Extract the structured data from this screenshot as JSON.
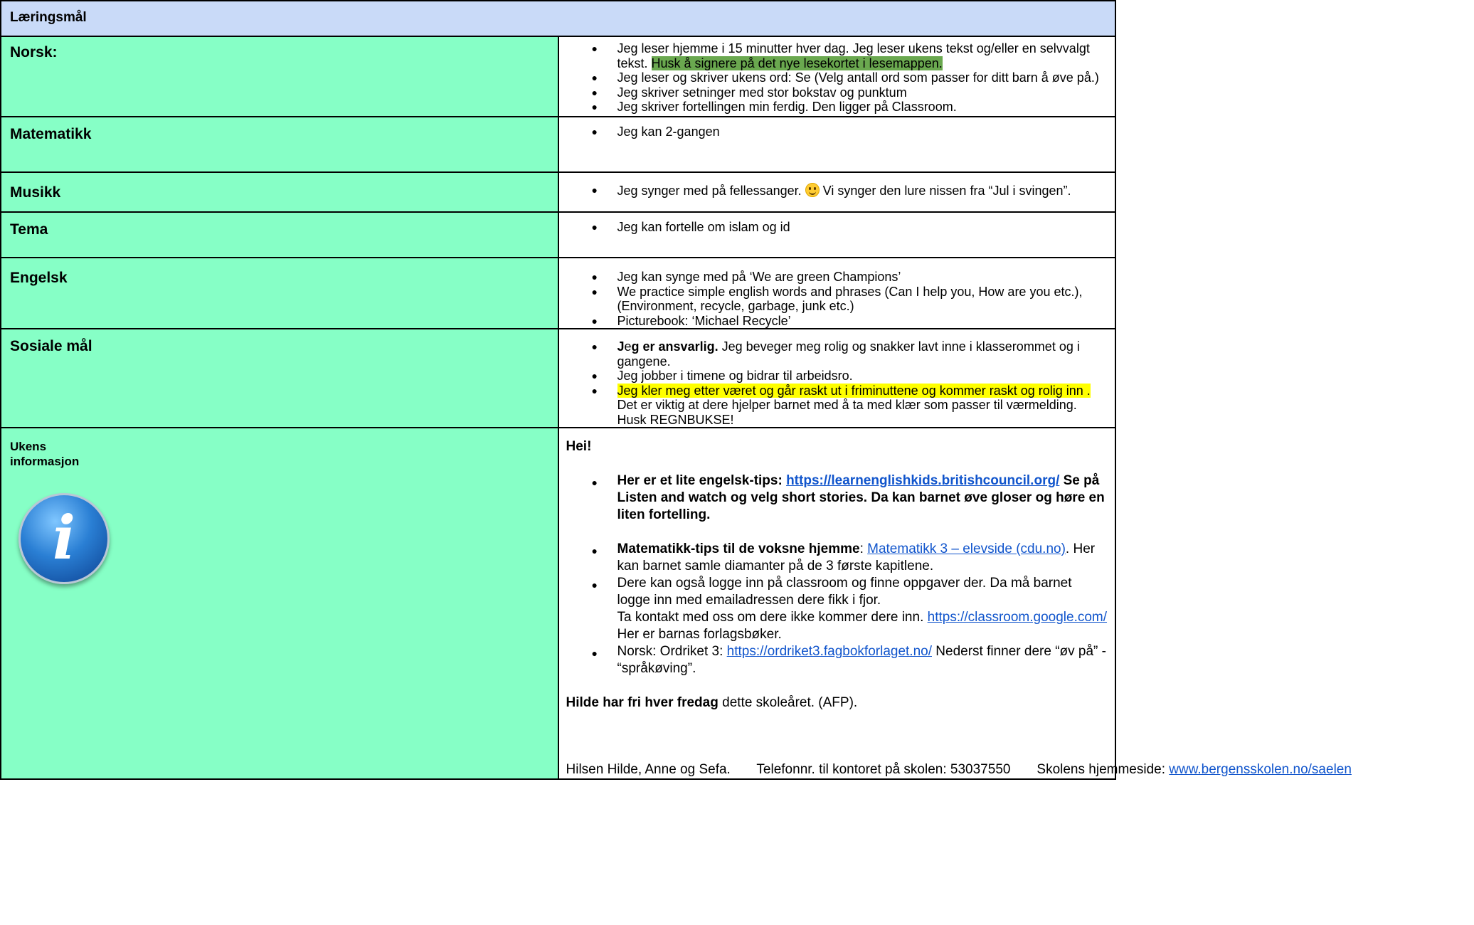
{
  "header": {
    "title": "Læringsmål"
  },
  "rows": {
    "norsk": {
      "label": "Norsk:",
      "b1": "Jeg leser hjemme i 15 minutter hver dag. Jeg leser ukens tekst og/eller en selvvalgt tekst. ",
      "b1_highlight": "Husk å signere på det nye lesekortet i lesemappen.",
      "b2": "Jeg leser og skriver ukens ord: Se (Velg antall ord som passer for ditt barn å øve på.)",
      "b3": "Jeg skriver setninger med stor bokstav og punktum",
      "b4": "Jeg skriver fortellingen min ferdig. Den ligger på Classroom."
    },
    "matematikk": {
      "label": "Matematikk",
      "b1": "Jeg kan 2-gangen"
    },
    "musikk": {
      "label": "Musikk",
      "b1_before": "Jeg synger med på fellessanger. ",
      "b1_after": " Vi synger den lure nissen fra “Jul i svingen”."
    },
    "tema": {
      "label": "Tema",
      "b1": "Jeg kan fortelle om islam og id"
    },
    "engelsk": {
      "label": "Engelsk",
      "b1": "Jeg kan synge med på ‘We are green Champions’",
      "b2": "We practice simple english words and phrases (Can I help you, How are you etc.), (Environment, recycle, garbage, junk etc.)",
      "b3": "Picturebook: ‘Michael Recycle’"
    },
    "sosiale": {
      "label": "Sosiale mål",
      "b1_bold_j": "J",
      "b1_plain_e": "e",
      "b1_bold": "g er ansvarlig.",
      "b1_rest": " Jeg beveger meg rolig og snakker lavt inne i klasserommet og i gangene.",
      "b2": "Jeg jobber i timene og bidrar til arbeidsro.",
      "b3_highlight": "Jeg kler meg etter været og går raskt ut i friminuttene og kommer raskt og rolig inn .",
      "b3_rest": " Det er viktig at dere hjelper barnet med å ta med klær som passer til  værmelding. Husk REGNBUKSE!"
    },
    "info": {
      "label_line1": "Ukens",
      "label_line2": "informasjon",
      "icon": "info-icon",
      "greeting": "Hei!",
      "tip1_bold": "Her er et lite engelsk-tips: ",
      "tip1_link": "https://learnenglishkids.britishcouncil.org/",
      "tip1_rest": " Se på Listen and watch og velg short stories. Da kan barnet øve gloser og høre en liten fortelling.",
      "tip2_bold": "Matematikk-tips til de voksne hjemme",
      "tip2_colon": ":  ",
      "tip2_link": "Matematikk 3 – elevside (cdu.no)",
      "tip2_rest": ". Her kan barnet samle diamanter på de 3 første kapitlene.",
      "tip3_line1": "Dere kan også logge inn på classroom og finne oppgaver der. Da må barnet logge inn med emailadressen dere fikk i fjor.",
      "tip3_line2": "Ta kontakt med oss om dere ikke kommer dere inn. ",
      "tip3_link": "https://classroom.google.com/",
      "tip3_rest": "  Her er barnas forlagsbøker.",
      "tip4_before": "Norsk: Ordriket 3: ",
      "tip4_link": "https://ordriket3.fagbokforlaget.no/",
      "tip4_rest": "  Nederst finner dere “øv på” - “språkøving”.",
      "hilde_bold": "Hilde har fri hver fredag",
      "hilde_rest": " dette skoleåret. (AFP).",
      "footer_text": "Hilsen Hilde, Anne og Sefa.       Telefonnr. til kontoret på skolen: 53037550       Skolens hjemmeside: ",
      "footer_link": "www.bergensskolen.no/saelen"
    }
  }
}
